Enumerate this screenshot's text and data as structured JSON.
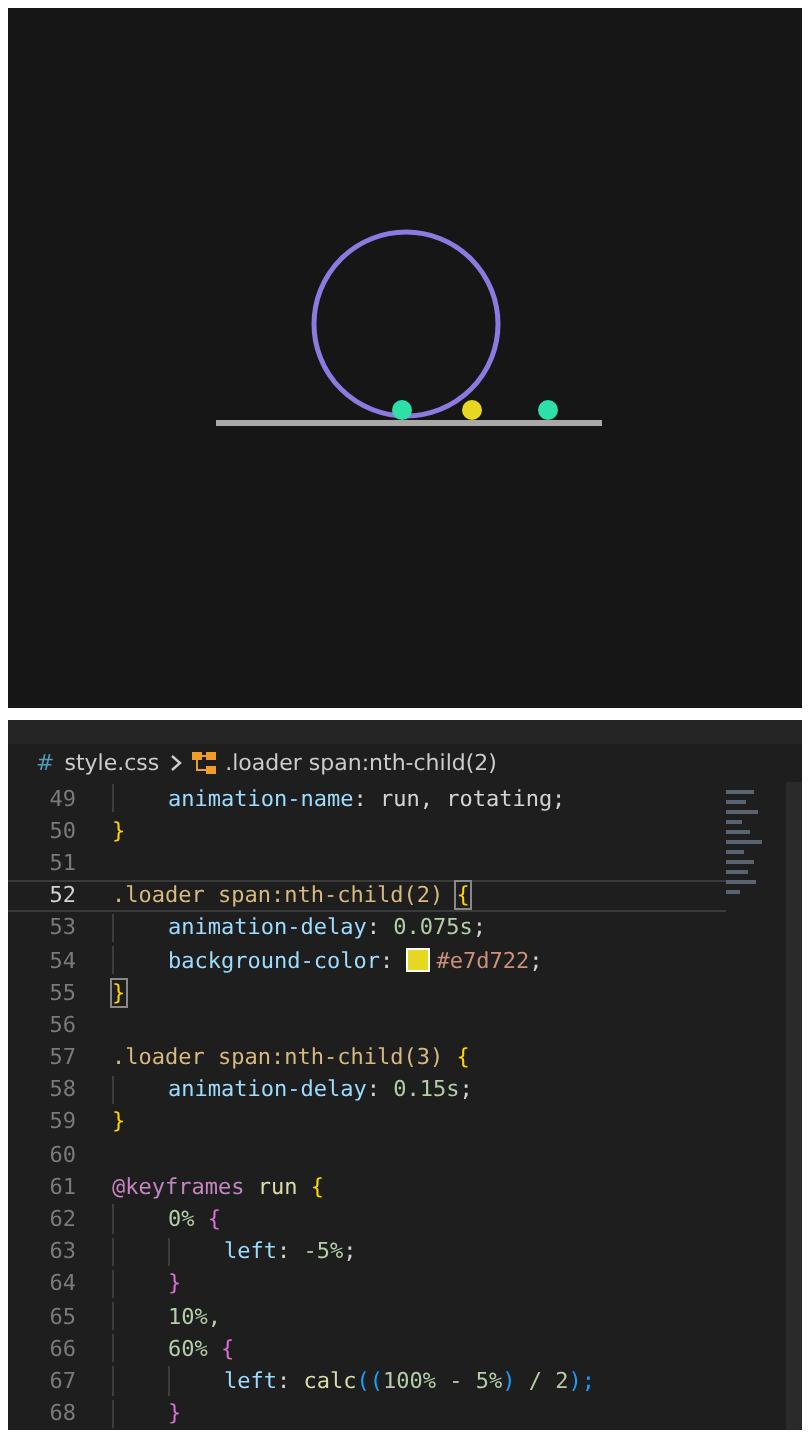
{
  "preview": {
    "balls": [
      {
        "color": "#2ee0a8"
      },
      {
        "color": "#e7d722"
      },
      {
        "color": "#2ee0a8"
      }
    ]
  },
  "breadcrumb": {
    "file_glyph": "#",
    "file": "style.css",
    "symbol": ".loader span:nth-child(2)"
  },
  "lines": [
    {
      "number": "49",
      "kind": "nested",
      "current": false,
      "tokens": [
        {
          "text": "animation-name",
          "kind": "property"
        },
        {
          "text": ": ",
          "kind": "punct"
        },
        {
          "text": "run, rotating;",
          "kind": "plain"
        }
      ]
    },
    {
      "number": "50",
      "kind": "top",
      "current": false,
      "tokens": [
        {
          "text": "}",
          "kind": "brace"
        }
      ]
    },
    {
      "number": "51",
      "kind": "top",
      "current": false
    },
    {
      "number": "52",
      "kind": "top",
      "current": true,
      "tokens": [
        {
          "text": ".loader span:nth-child(2) ",
          "kind": "selector"
        },
        {
          "text": "{",
          "kind": "brace-match"
        }
      ]
    },
    {
      "number": "53",
      "kind": "nested",
      "current": false,
      "tokens": [
        {
          "text": "animation-delay",
          "kind": "property"
        },
        {
          "text": ": ",
          "kind": "punct"
        },
        {
          "text": "0.075s",
          "kind": "number"
        },
        {
          "text": ";",
          "kind": "punct"
        }
      ]
    },
    {
      "number": "54",
      "kind": "nested",
      "current": false,
      "tokens": [
        {
          "text": "background-color",
          "kind": "property"
        },
        {
          "text": ": ",
          "kind": "punct"
        },
        {
          "kind": "swatch",
          "color": "#e7d722"
        },
        {
          "text": "#e7d722",
          "kind": "color"
        },
        {
          "text": ";",
          "kind": "punct"
        }
      ]
    },
    {
      "number": "55",
      "kind": "top",
      "current": false,
      "tokens": [
        {
          "text": "}",
          "kind": "brace-match"
        }
      ]
    },
    {
      "number": "56",
      "kind": "top",
      "current": false
    },
    {
      "number": "57",
      "kind": "top",
      "current": false,
      "tokens": [
        {
          "text": ".loader span:nth-child(3) ",
          "kind": "selector"
        },
        {
          "text": "{",
          "kind": "brace"
        }
      ]
    },
    {
      "number": "58",
      "kind": "nested",
      "current": false,
      "tokens": [
        {
          "text": "animation-delay",
          "kind": "property"
        },
        {
          "text": ": ",
          "kind": "punct"
        },
        {
          "text": "0.15s",
          "kind": "number"
        },
        {
          "text": ";",
          "kind": "punct"
        }
      ]
    },
    {
      "number": "59",
      "kind": "top",
      "current": false,
      "tokens": [
        {
          "text": "}",
          "kind": "brace"
        }
      ]
    },
    {
      "number": "60",
      "kind": "top",
      "current": false
    },
    {
      "number": "61",
      "kind": "top",
      "current": false,
      "tokens": [
        {
          "text": "@keyframes",
          "kind": "keyword"
        },
        {
          "text": " run ",
          "kind": "name"
        },
        {
          "text": "{",
          "kind": "brace"
        }
      ]
    },
    {
      "number": "62",
      "kind": "nested",
      "current": false,
      "tokens": [
        {
          "text": "0% ",
          "kind": "number"
        },
        {
          "text": "{",
          "kind": "brace2"
        }
      ]
    },
    {
      "number": "63",
      "kind": "nested2",
      "current": false,
      "tokens": [
        {
          "text": "left",
          "kind": "property"
        },
        {
          "text": ": ",
          "kind": "punct"
        },
        {
          "text": "-5%",
          "kind": "number"
        },
        {
          "text": ";",
          "kind": "punct"
        }
      ]
    },
    {
      "number": "64",
      "kind": "nested",
      "current": false,
      "tokens": [
        {
          "text": "}",
          "kind": "brace2"
        }
      ]
    },
    {
      "number": "65",
      "kind": "nested",
      "current": false,
      "tokens": [
        {
          "text": "10%,",
          "kind": "number"
        }
      ]
    },
    {
      "number": "66",
      "kind": "nested",
      "current": false,
      "tokens": [
        {
          "text": "60% ",
          "kind": "number"
        },
        {
          "text": "{",
          "kind": "brace2"
        }
      ]
    },
    {
      "number": "67",
      "kind": "nested2",
      "current": false,
      "tokens": [
        {
          "text": "left",
          "kind": "property"
        },
        {
          "text": ": ",
          "kind": "punct"
        },
        {
          "text": "calc",
          "kind": "function"
        },
        {
          "text": "((",
          "kind": "brace3"
        },
        {
          "text": "100% - 5%",
          "kind": "number"
        },
        {
          "text": ")",
          "kind": "brace3"
        },
        {
          "text": " / 2",
          "kind": "number"
        },
        {
          "text": ");",
          "kind": "brace3"
        }
      ]
    },
    {
      "number": "68",
      "kind": "nested",
      "current": false,
      "tokens": [
        {
          "text": "}",
          "kind": "brace2"
        }
      ]
    }
  ]
}
